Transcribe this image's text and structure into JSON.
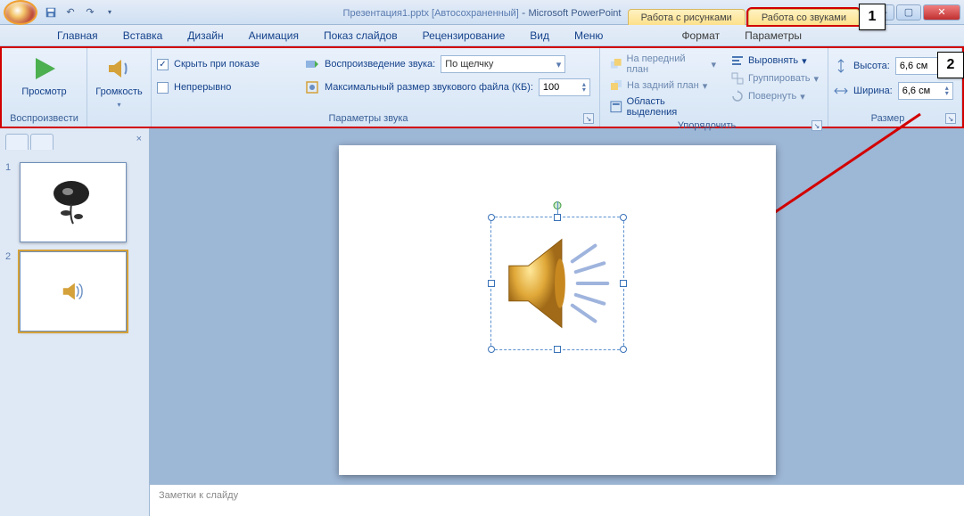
{
  "title": {
    "doc": "Презентация1.pptx [Автосохраненный]",
    "app": "Microsoft PowerPoint"
  },
  "context_tabs": {
    "pictures": "Работа с рисунками",
    "sounds": "Работа со звуками"
  },
  "tabs": [
    "Главная",
    "Вставка",
    "Дизайн",
    "Анимация",
    "Показ слайдов",
    "Рецензирование",
    "Вид",
    "Меню",
    "Формат",
    "Параметры"
  ],
  "ribbon": {
    "play_group": {
      "preview": "Просмотр",
      "label": "Воспроизвести"
    },
    "volume_group": {
      "volume": "Громкость"
    },
    "sound_options": {
      "hide_on_show": "Скрыть при показе",
      "loop": "Непрерывно",
      "play_sound": "Воспроизведение звука:",
      "play_sound_value": "По щелчку",
      "max_size": "Максимальный размер звукового файла (КБ):",
      "max_size_value": "100",
      "label": "Параметры звука"
    },
    "arrange": {
      "bring_front": "На передний план",
      "send_back": "На задний план",
      "selection_pane": "Область выделения",
      "align": "Выровнять",
      "group": "Группировать",
      "rotate": "Повернуть",
      "label": "Упорядочить"
    },
    "size": {
      "height_label": "Высота:",
      "height_value": "6,6 см",
      "width_label": "Ширина:",
      "width_value": "6,6 см",
      "label": "Размер"
    }
  },
  "callouts": {
    "c1": "1",
    "c2": "2"
  },
  "thumbs": {
    "s1": "1",
    "s2": "2"
  },
  "notes_placeholder": "Заметки к слайду"
}
